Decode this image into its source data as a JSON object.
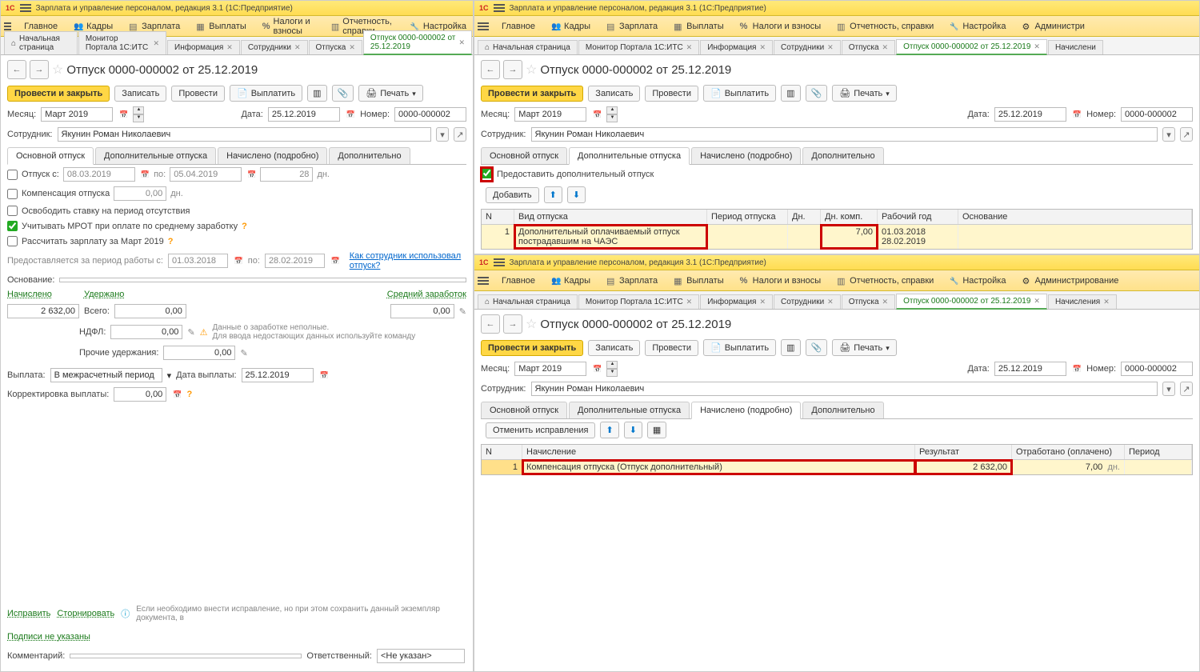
{
  "app_title": "Зарплата и управление персоналом, редакция 3.1  (1С:Предприятие)",
  "menu": {
    "home": "Главное",
    "staff": "Кадры",
    "salary": "Зарплата",
    "payments": "Выплаты",
    "taxes": "Налоги и взносы",
    "reports": "Отчетность, справки",
    "setup": "Настройка",
    "admin": "Администрирование",
    "admin_short": "Администри"
  },
  "tabs": {
    "home": "Начальная страница",
    "monitor": "Монитор Портала 1С:ИТС",
    "info": "Информация",
    "emp": "Сотрудники",
    "vac": "Отпуска",
    "doc": "Отпуск 0000-000002 от 25.12.2019",
    "accr": "Начисления",
    "accr_short": "Начислени"
  },
  "doc": {
    "title": "Отпуск 0000-000002 от 25.12.2019",
    "btn_post_close": "Провести и закрыть",
    "btn_save": "Записать",
    "btn_post": "Провести",
    "btn_pay": "Выплатить",
    "btn_print": "Печать",
    "month_lbl": "Месяц:",
    "month": "Март 2019",
    "date_lbl": "Дата:",
    "date": "25.12.2019",
    "num_lbl": "Номер:",
    "num": "0000-000002",
    "emp_lbl": "Сотрудник:",
    "emp": "Якунин Роман Николаевич"
  },
  "innerTabs": {
    "t1": "Основной отпуск",
    "t2": "Дополнительные отпуска",
    "t3": "Начислено (подробно)",
    "t4": "Дополнительно"
  },
  "left": {
    "otp": "Отпуск   с:",
    "d1": "08.03.2019",
    "po": "по:",
    "d2": "05.04.2019",
    "days": "28",
    "dn": "дн.",
    "comp": "Компенсация отпуска",
    "comp_days": "0,00",
    "free": "Освободить ставку на период отсутствия",
    "mrot": "Учитывать МРОТ при оплате по среднему заработку",
    "recalc": "Рассчитать зарплату за Март 2019",
    "period_lbl": "Предоставляется за период работы с:",
    "p1": "01.03.2018",
    "p2": "28.02.2019",
    "howused": "Как сотрудник использовал отпуск?",
    "basis_lbl": "Основание:",
    "hdr_accr": "Начислено",
    "hdr_hold": "Удержано",
    "hdr_avg": "Средний заработок",
    "accr_val": "2 632,00",
    "total": "Всего:",
    "total_v": "0,00",
    "ndfl": "НДФЛ:",
    "ndfl_v": "0,00",
    "other": "Прочие удержания:",
    "other_v": "0,00",
    "avg_v": "0,00",
    "warn1": "Данные о заработке неполные.",
    "warn2": "Для ввода недостающих данных используйте команду",
    "pay_lbl": "Выплата:",
    "pay_val": "В межрасчетный период",
    "paydate_lbl": "Дата выплаты:",
    "paydate": "25.12.2019",
    "corr_lbl": "Корректировка выплаты:",
    "corr_v": "0,00",
    "fix": "Исправить",
    "storno": "Сторнировать",
    "fixnote": "Если необходимо внести исправление, но при этом сохранить данный экземпляр документа, в",
    "signs": "Подписи не указаны",
    "comment_lbl": "Комментарий:",
    "resp_lbl": "Ответственный:",
    "resp_v": "<Не указан>"
  },
  "p2": {
    "extra_cb": "Предоставить дополнительный отпуск",
    "add": "Добавить",
    "cols": {
      "n": "N",
      "type": "Вид отпуска",
      "period": "Период отпуска",
      "days": "Дн.",
      "comp": "Дн. комп.",
      "year": "Рабочий год",
      "basis": "Основание"
    },
    "row": {
      "n": "1",
      "type": "Дополнительный оплачиваемый отпуск пострадавшим на ЧАЭС",
      "comp": "7,00",
      "y1": "01.03.2018",
      "y2": "28.02.2019"
    }
  },
  "p3": {
    "undo": "Отменить исправления",
    "cols": {
      "n": "N",
      "accr": "Начисление",
      "res": "Результат",
      "worked": "Отработано (оплачено)",
      "period": "Период"
    },
    "row": {
      "n": "1",
      "accr": "Компенсация отпуска (Отпуск дополнительный)",
      "res": "2 632,00",
      "worked": "7,00",
      "dn": "дн."
    }
  }
}
